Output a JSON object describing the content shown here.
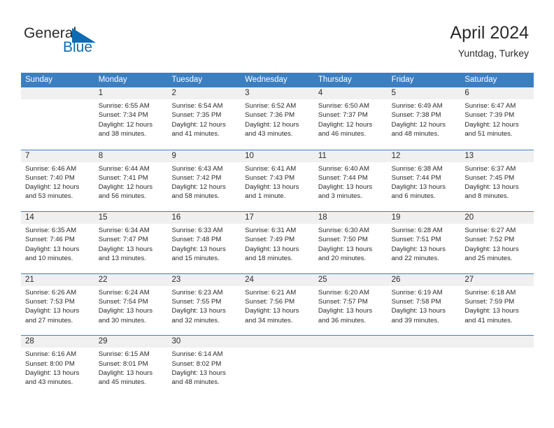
{
  "brand": {
    "name_part1": "General",
    "name_part2": "Blue",
    "triangle_icon": "triangle-icon",
    "accent_color": "#0d6cb5"
  },
  "header": {
    "title": "April 2024",
    "location": "Yuntdag, Turkey"
  },
  "theme": {
    "header_blue": "#3c7fc1",
    "daynum_band": "#f0f0f0",
    "text": "#2b2b2b"
  },
  "weekdays": [
    "Sunday",
    "Monday",
    "Tuesday",
    "Wednesday",
    "Thursday",
    "Friday",
    "Saturday"
  ],
  "weeks": [
    {
      "days": [
        {
          "num": "",
          "sunrise": "",
          "sunset": "",
          "daylight1": "",
          "daylight2": ""
        },
        {
          "num": "1",
          "sunrise": "Sunrise: 6:55 AM",
          "sunset": "Sunset: 7:34 PM",
          "daylight1": "Daylight: 12 hours",
          "daylight2": "and 38 minutes."
        },
        {
          "num": "2",
          "sunrise": "Sunrise: 6:54 AM",
          "sunset": "Sunset: 7:35 PM",
          "daylight1": "Daylight: 12 hours",
          "daylight2": "and 41 minutes."
        },
        {
          "num": "3",
          "sunrise": "Sunrise: 6:52 AM",
          "sunset": "Sunset: 7:36 PM",
          "daylight1": "Daylight: 12 hours",
          "daylight2": "and 43 minutes."
        },
        {
          "num": "4",
          "sunrise": "Sunrise: 6:50 AM",
          "sunset": "Sunset: 7:37 PM",
          "daylight1": "Daylight: 12 hours",
          "daylight2": "and 46 minutes."
        },
        {
          "num": "5",
          "sunrise": "Sunrise: 6:49 AM",
          "sunset": "Sunset: 7:38 PM",
          "daylight1": "Daylight: 12 hours",
          "daylight2": "and 48 minutes."
        },
        {
          "num": "6",
          "sunrise": "Sunrise: 6:47 AM",
          "sunset": "Sunset: 7:39 PM",
          "daylight1": "Daylight: 12 hours",
          "daylight2": "and 51 minutes."
        }
      ]
    },
    {
      "days": [
        {
          "num": "7",
          "sunrise": "Sunrise: 6:46 AM",
          "sunset": "Sunset: 7:40 PM",
          "daylight1": "Daylight: 12 hours",
          "daylight2": "and 53 minutes."
        },
        {
          "num": "8",
          "sunrise": "Sunrise: 6:44 AM",
          "sunset": "Sunset: 7:41 PM",
          "daylight1": "Daylight: 12 hours",
          "daylight2": "and 56 minutes."
        },
        {
          "num": "9",
          "sunrise": "Sunrise: 6:43 AM",
          "sunset": "Sunset: 7:42 PM",
          "daylight1": "Daylight: 12 hours",
          "daylight2": "and 58 minutes."
        },
        {
          "num": "10",
          "sunrise": "Sunrise: 6:41 AM",
          "sunset": "Sunset: 7:43 PM",
          "daylight1": "Daylight: 13 hours",
          "daylight2": "and 1 minute."
        },
        {
          "num": "11",
          "sunrise": "Sunrise: 6:40 AM",
          "sunset": "Sunset: 7:44 PM",
          "daylight1": "Daylight: 13 hours",
          "daylight2": "and 3 minutes."
        },
        {
          "num": "12",
          "sunrise": "Sunrise: 6:38 AM",
          "sunset": "Sunset: 7:44 PM",
          "daylight1": "Daylight: 13 hours",
          "daylight2": "and 6 minutes."
        },
        {
          "num": "13",
          "sunrise": "Sunrise: 6:37 AM",
          "sunset": "Sunset: 7:45 PM",
          "daylight1": "Daylight: 13 hours",
          "daylight2": "and 8 minutes."
        }
      ]
    },
    {
      "days": [
        {
          "num": "14",
          "sunrise": "Sunrise: 6:35 AM",
          "sunset": "Sunset: 7:46 PM",
          "daylight1": "Daylight: 13 hours",
          "daylight2": "and 10 minutes."
        },
        {
          "num": "15",
          "sunrise": "Sunrise: 6:34 AM",
          "sunset": "Sunset: 7:47 PM",
          "daylight1": "Daylight: 13 hours",
          "daylight2": "and 13 minutes."
        },
        {
          "num": "16",
          "sunrise": "Sunrise: 6:33 AM",
          "sunset": "Sunset: 7:48 PM",
          "daylight1": "Daylight: 13 hours",
          "daylight2": "and 15 minutes."
        },
        {
          "num": "17",
          "sunrise": "Sunrise: 6:31 AM",
          "sunset": "Sunset: 7:49 PM",
          "daylight1": "Daylight: 13 hours",
          "daylight2": "and 18 minutes."
        },
        {
          "num": "18",
          "sunrise": "Sunrise: 6:30 AM",
          "sunset": "Sunset: 7:50 PM",
          "daylight1": "Daylight: 13 hours",
          "daylight2": "and 20 minutes."
        },
        {
          "num": "19",
          "sunrise": "Sunrise: 6:28 AM",
          "sunset": "Sunset: 7:51 PM",
          "daylight1": "Daylight: 13 hours",
          "daylight2": "and 22 minutes."
        },
        {
          "num": "20",
          "sunrise": "Sunrise: 6:27 AM",
          "sunset": "Sunset: 7:52 PM",
          "daylight1": "Daylight: 13 hours",
          "daylight2": "and 25 minutes."
        }
      ]
    },
    {
      "days": [
        {
          "num": "21",
          "sunrise": "Sunrise: 6:26 AM",
          "sunset": "Sunset: 7:53 PM",
          "daylight1": "Daylight: 13 hours",
          "daylight2": "and 27 minutes."
        },
        {
          "num": "22",
          "sunrise": "Sunrise: 6:24 AM",
          "sunset": "Sunset: 7:54 PM",
          "daylight1": "Daylight: 13 hours",
          "daylight2": "and 30 minutes."
        },
        {
          "num": "23",
          "sunrise": "Sunrise: 6:23 AM",
          "sunset": "Sunset: 7:55 PM",
          "daylight1": "Daylight: 13 hours",
          "daylight2": "and 32 minutes."
        },
        {
          "num": "24",
          "sunrise": "Sunrise: 6:21 AM",
          "sunset": "Sunset: 7:56 PM",
          "daylight1": "Daylight: 13 hours",
          "daylight2": "and 34 minutes."
        },
        {
          "num": "25",
          "sunrise": "Sunrise: 6:20 AM",
          "sunset": "Sunset: 7:57 PM",
          "daylight1": "Daylight: 13 hours",
          "daylight2": "and 36 minutes."
        },
        {
          "num": "26",
          "sunrise": "Sunrise: 6:19 AM",
          "sunset": "Sunset: 7:58 PM",
          "daylight1": "Daylight: 13 hours",
          "daylight2": "and 39 minutes."
        },
        {
          "num": "27",
          "sunrise": "Sunrise: 6:18 AM",
          "sunset": "Sunset: 7:59 PM",
          "daylight1": "Daylight: 13 hours",
          "daylight2": "and 41 minutes."
        }
      ]
    },
    {
      "days": [
        {
          "num": "28",
          "sunrise": "Sunrise: 6:16 AM",
          "sunset": "Sunset: 8:00 PM",
          "daylight1": "Daylight: 13 hours",
          "daylight2": "and 43 minutes."
        },
        {
          "num": "29",
          "sunrise": "Sunrise: 6:15 AM",
          "sunset": "Sunset: 8:01 PM",
          "daylight1": "Daylight: 13 hours",
          "daylight2": "and 45 minutes."
        },
        {
          "num": "30",
          "sunrise": "Sunrise: 6:14 AM",
          "sunset": "Sunset: 8:02 PM",
          "daylight1": "Daylight: 13 hours",
          "daylight2": "and 48 minutes."
        },
        {
          "num": "",
          "sunrise": "",
          "sunset": "",
          "daylight1": "",
          "daylight2": ""
        },
        {
          "num": "",
          "sunrise": "",
          "sunset": "",
          "daylight1": "",
          "daylight2": ""
        },
        {
          "num": "",
          "sunrise": "",
          "sunset": "",
          "daylight1": "",
          "daylight2": ""
        },
        {
          "num": "",
          "sunrise": "",
          "sunset": "",
          "daylight1": "",
          "daylight2": ""
        }
      ]
    }
  ]
}
